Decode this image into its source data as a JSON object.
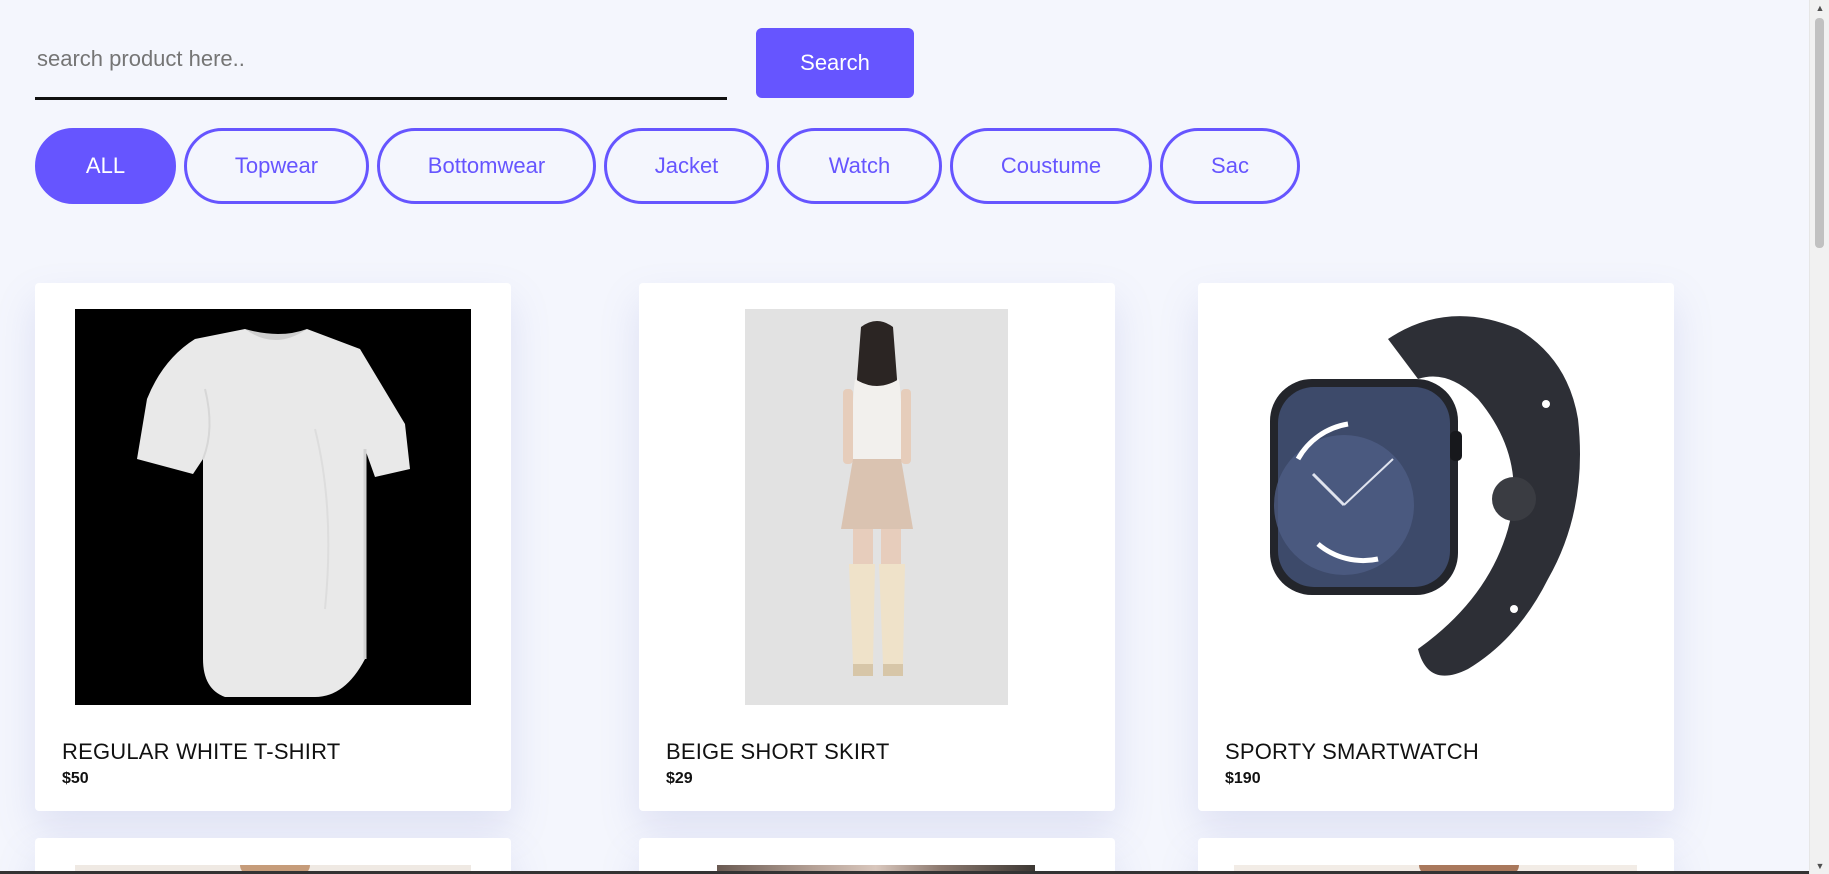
{
  "search": {
    "placeholder": "search product here..",
    "button_label": "Search"
  },
  "filters": [
    {
      "label": "ALL",
      "active": true
    },
    {
      "label": "Topwear",
      "active": false
    },
    {
      "label": "Bottomwear",
      "active": false
    },
    {
      "label": "Jacket",
      "active": false
    },
    {
      "label": "Watch",
      "active": false
    },
    {
      "label": "Coustume",
      "active": false
    },
    {
      "label": "Sac",
      "active": false
    }
  ],
  "products": [
    {
      "name": "REGULAR WHITE T-SHIRT",
      "price": "$50"
    },
    {
      "name": "BEIGE SHORT SKIRT",
      "price": "$29"
    },
    {
      "name": "SPORTY SMARTWATCH",
      "price": "$190"
    }
  ],
  "colors": {
    "accent": "#6655ff",
    "background": "#f4f6fd",
    "card": "#ffffff"
  }
}
